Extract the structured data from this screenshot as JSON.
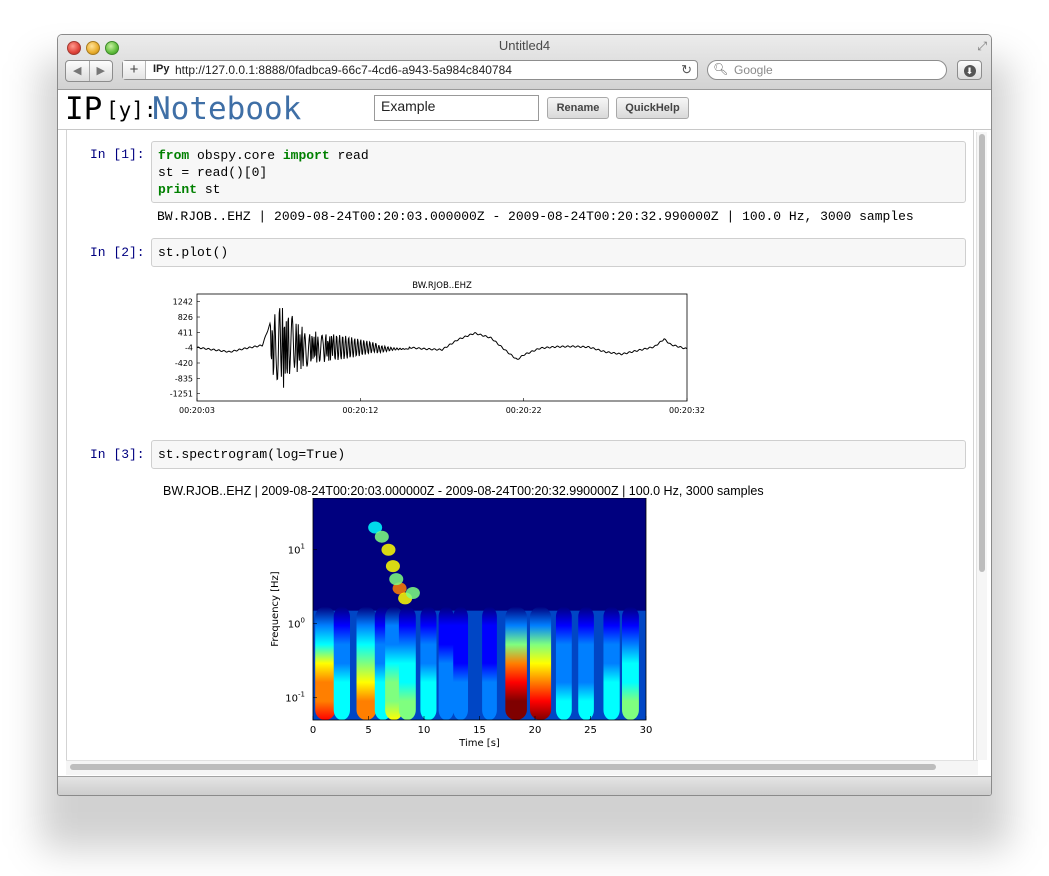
{
  "window": {
    "title": "Untitled4",
    "url_favicon": "IPy",
    "url": "http://127.0.0.1:8888/0fadbca9-66c7-4cd6-a943-5a984c840784",
    "search_placeholder": "Google"
  },
  "notebook": {
    "logo_ip": "IP",
    "logo_y": "[y]:",
    "logo_nb": "Notebook",
    "name": "Example",
    "rename_label": "Rename",
    "quickhelp_label": "QuickHelp"
  },
  "cells": [
    {
      "prompt": "In [1]:",
      "code": {
        "kw1": "from",
        "t1": " obspy.core ",
        "kw2": "import",
        "t2": " read",
        "line2": "st = read()[0]",
        "kw3": "print",
        "t3": " st"
      },
      "output": "BW.RJOB..EHZ | 2009-08-24T00:20:03.000000Z - 2009-08-24T00:20:32.990000Z | 100.0 Hz, 3000 samples"
    },
    {
      "prompt": "In [2]:",
      "code": "st.plot()"
    },
    {
      "prompt": "In [3]:",
      "code": "st.spectrogram(log=True)",
      "output_title": "BW.RJOB..EHZ | 2009-08-24T00:20:03.000000Z - 2009-08-24T00:20:32.990000Z | 100.0 Hz, 3000 samples"
    }
  ],
  "chart_data": [
    {
      "type": "line",
      "title": "BW.RJOB..EHZ",
      "y_ticks": [
        "1242",
        "826",
        "411",
        "-4",
        "-420",
        "-835",
        "-1251"
      ],
      "x_ticks": [
        "00:20:03",
        "00:20:12",
        "00:20:22",
        "00:20:32"
      ],
      "ylim": [
        -1450,
        1450
      ],
      "duration_s": 30,
      "series": [
        {
          "envelope": [
            [
              0,
              0
            ],
            [
              1,
              -60
            ],
            [
              2,
              -120
            ],
            [
              3,
              -20
            ],
            [
              4,
              60
            ],
            [
              4.6,
              800
            ],
            [
              5,
              1250
            ],
            [
              5.6,
              1000
            ],
            [
              6.2,
              700
            ],
            [
              7,
              450
            ],
            [
              8,
              420
            ],
            [
              9,
              360
            ],
            [
              10,
              250
            ],
            [
              11,
              130
            ],
            [
              12,
              40
            ],
            [
              13,
              0
            ],
            [
              14,
              -40
            ],
            [
              15,
              -60
            ],
            [
              16,
              220
            ],
            [
              17,
              390
            ],
            [
              18,
              260
            ],
            [
              19,
              -120
            ],
            [
              19.6,
              -330
            ],
            [
              20,
              -200
            ],
            [
              21,
              -20
            ],
            [
              22,
              20
            ],
            [
              23,
              30
            ],
            [
              24,
              10
            ],
            [
              25,
              -120
            ],
            [
              26,
              -180
            ],
            [
              27,
              -80
            ],
            [
              28,
              20
            ],
            [
              28.6,
              230
            ],
            [
              29,
              80
            ],
            [
              30,
              -40
            ]
          ]
        }
      ]
    },
    {
      "type": "heatmap",
      "title": "BW.RJOB..EHZ | 2009-08-24T00:20:03.000000Z - 2009-08-24T00:20:32.990000Z | 100.0 Hz, 3000 samples",
      "xlabel": "Time [s]",
      "ylabel": "Frequency [Hz]",
      "x_ticks": [
        "0",
        "5",
        "10",
        "15",
        "20",
        "25",
        "30"
      ],
      "y_ticks": [
        {
          "base": "10",
          "exp": "1"
        },
        {
          "base": "10",
          "exp": "0"
        },
        {
          "base": "10",
          "exp": "-1"
        }
      ],
      "xlim": [
        0,
        30
      ],
      "ylim_hz": [
        0.05,
        50
      ],
      "scale_y": "log",
      "colormap": [
        "#00007f",
        "#0000ff",
        "#007fff",
        "#00ffff",
        "#7fff7f",
        "#ffff00",
        "#ff7f00",
        "#ff0000",
        "#7f0000"
      ],
      "columns": [
        {
          "t": 1.1,
          "peak": 0.78
        },
        {
          "t": 2.6,
          "peak": 0.35
        },
        {
          "t": 4.8,
          "peak": 0.72
        },
        {
          "t": 6.3,
          "peak": 0.35
        },
        {
          "t": 7.3,
          "peak": 0.52
        },
        {
          "t": 8.5,
          "peak": 0.42
        },
        {
          "t": 10.4,
          "peak": 0.33
        },
        {
          "t": 12.0,
          "peak": 0.22
        },
        {
          "t": 13.3,
          "peak": 0.18
        },
        {
          "t": 15.9,
          "peak": 0.18
        },
        {
          "t": 18.3,
          "peak": 0.95
        },
        {
          "t": 20.5,
          "peak": 0.9
        },
        {
          "t": 22.6,
          "peak": 0.3
        },
        {
          "t": 24.6,
          "peak": 0.28
        },
        {
          "t": 26.9,
          "peak": 0.35
        },
        {
          "t": 28.6,
          "peak": 0.42
        }
      ]
    }
  ]
}
